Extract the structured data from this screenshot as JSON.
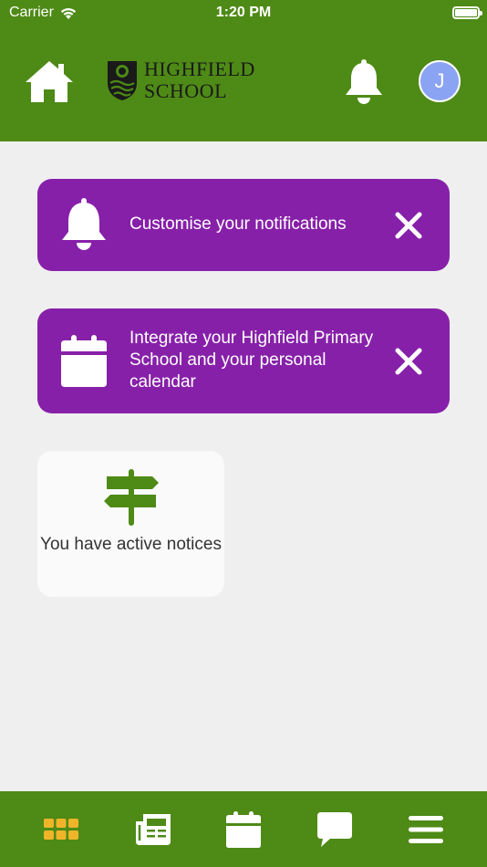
{
  "status_bar": {
    "carrier": "Carrier",
    "time": "1:20 PM"
  },
  "header": {
    "logo_line1": "HIGHFIELD",
    "logo_line2": "SCHOOL",
    "avatar_initial": "J",
    "icons": [
      "home-icon",
      "school-crest-icon",
      "bell-icon"
    ]
  },
  "cards": {
    "notifications": {
      "text": "Customise your notifications",
      "icon": "bell-icon"
    },
    "calendar": {
      "text": "Integrate your Highfield Primary School and your personal calendar",
      "icon": "calendar-icon"
    }
  },
  "notice_tile": {
    "text": "You have active notices",
    "icon": "signpost-icon"
  },
  "tabbar": {
    "tabs": [
      {
        "icon": "grid-icon",
        "active": true
      },
      {
        "icon": "newspaper-icon",
        "active": false
      },
      {
        "icon": "calendar-icon",
        "active": false
      },
      {
        "icon": "chat-bubble-icon",
        "active": false
      },
      {
        "icon": "hamburger-menu-icon",
        "active": false
      }
    ]
  },
  "colors": {
    "brand_green": "#4e8a16",
    "card_purple": "#8720a9",
    "avatar_blue": "#8aa3f3",
    "active_tab": "#f0b429",
    "background": "#efefef"
  }
}
